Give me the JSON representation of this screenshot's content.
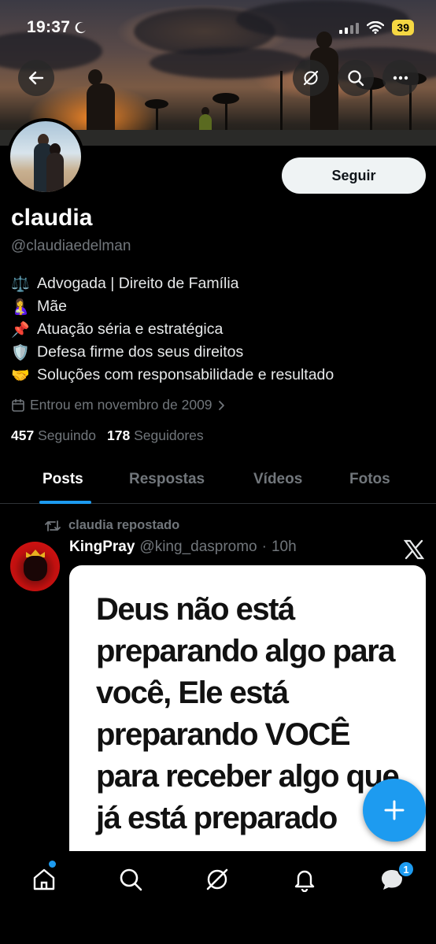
{
  "status_bar": {
    "time": "19:37",
    "battery": "39"
  },
  "profile": {
    "display_name": "claudia",
    "handle": "@claudiaedelman",
    "follow_label": "Seguir",
    "bio": [
      {
        "emoji": "⚖️",
        "text": "Advogada | Direito de Família"
      },
      {
        "emoji": "🤱",
        "text": "Mãe"
      },
      {
        "emoji": "📌",
        "text": "Atuação séria e estratégica"
      },
      {
        "emoji": "🛡️",
        "text": "Defesa firme dos seus direitos"
      },
      {
        "emoji": "🤝",
        "text": "Soluções com responsabilidade e resultado"
      }
    ],
    "joined": "Entrou em novembro de 2009",
    "following_count": "457",
    "following_label": "Seguindo",
    "followers_count": "178",
    "followers_label": "Seguidores"
  },
  "tabs": [
    "Posts",
    "Respostas",
    "Vídeos",
    "Fotos"
  ],
  "post": {
    "repost_label": "claudia repostado",
    "author": "KingPray",
    "author_handle": "@king_daspromo",
    "time": "10h",
    "image_text": "Deus não está preparando algo para você, Ele está preparando VOCÊ para receber algo que já está preparado"
  },
  "bottom_nav": {
    "messages_badge": "1"
  },
  "colors": {
    "accent": "#1d9bf0",
    "background": "#000000",
    "muted_text": "#71767b"
  },
  "icons": [
    "back-icon",
    "grok-icon",
    "search-icon",
    "more-icon",
    "calendar-icon",
    "chevron-right-icon",
    "repost-icon",
    "x-logo-icon",
    "plus-icon",
    "home-icon",
    "explore-icon",
    "notifications-icon",
    "messages-icon"
  ]
}
